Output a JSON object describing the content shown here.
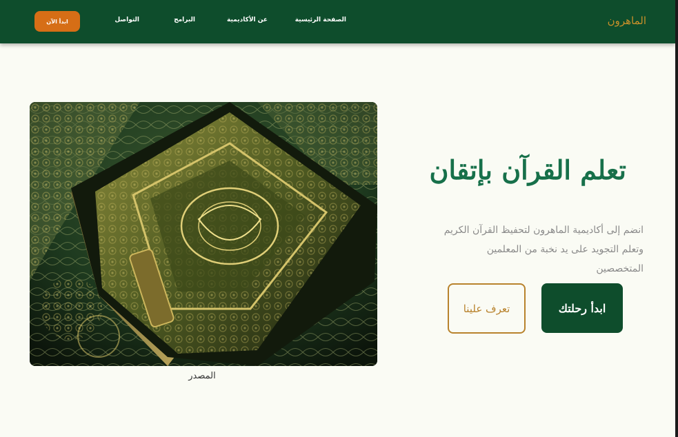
{
  "brand": "الماهرون",
  "nav": {
    "home": "الصفحة الرئيسية",
    "about": "عن الأكاديمية",
    "programs": "البرامج",
    "contact": "التواصل",
    "cta": "ابدأ الآن"
  },
  "hero": {
    "title": "تعلم القرآن بإتقان",
    "description": "انضم إلى أكاديمية الماهرون لتحفيظ القرآن الكريم وتعلم التجويد على يد نخبة من المعلمين المتخصصين",
    "primary_button": "ابدأ رحلتك",
    "secondary_button": "تعرف علينا"
  },
  "image": {
    "icon": "quran-book-image",
    "caption": "المصدر"
  },
  "colors": {
    "nav_bg": "#0e4d2c",
    "brand": "#c9902a",
    "cta": "#d66e16",
    "title": "#17704a",
    "outline": "#b8822c",
    "page_bg": "#fafbf4"
  }
}
